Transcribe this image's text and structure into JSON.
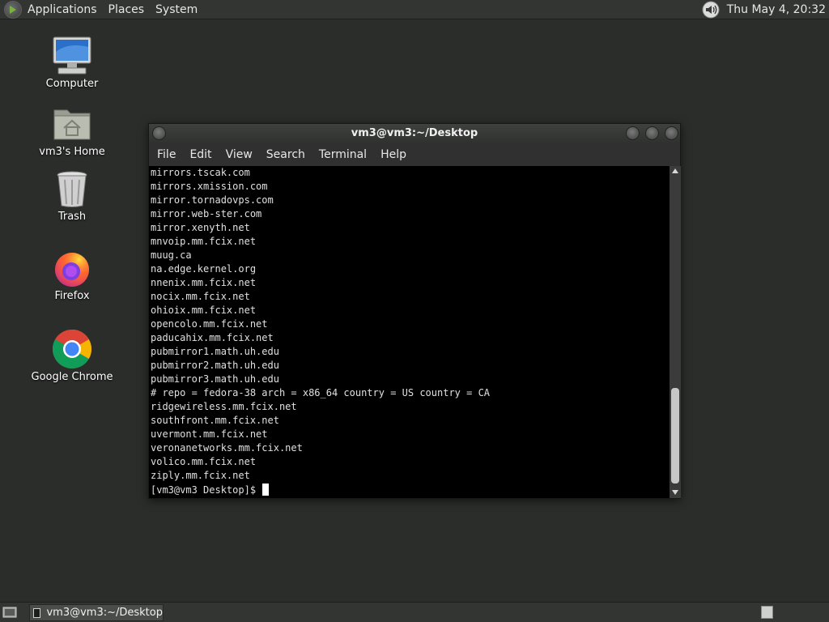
{
  "top_panel": {
    "menus": [
      "Applications",
      "Places",
      "System"
    ],
    "clock": "Thu May  4, 20:32"
  },
  "desktop": {
    "icons": [
      {
        "label": "Computer",
        "icon": "computer-icon"
      },
      {
        "label": "vm3's Home",
        "icon": "home-folder-icon"
      },
      {
        "label": "Trash",
        "icon": "trash-icon"
      },
      {
        "label": "Firefox",
        "icon": "firefox-icon"
      },
      {
        "label": "Google Chrome",
        "icon": "chrome-icon"
      }
    ]
  },
  "terminal": {
    "title": "vm3@vm3:~/Desktop",
    "menus": [
      "File",
      "Edit",
      "View",
      "Search",
      "Terminal",
      "Help"
    ],
    "lines": [
      "mirrors.tscak.com",
      "mirrors.xmission.com",
      "mirror.tornadovps.com",
      "mirror.web-ster.com",
      "mirror.xenyth.net",
      "mnvoip.mm.fcix.net",
      "muug.ca",
      "na.edge.kernel.org",
      "nnenix.mm.fcix.net",
      "nocix.mm.fcix.net",
      "ohioix.mm.fcix.net",
      "opencolo.mm.fcix.net",
      "paducahix.mm.fcix.net",
      "pubmirror1.math.uh.edu",
      "pubmirror2.math.uh.edu",
      "pubmirror3.math.uh.edu",
      "# repo = fedora-38 arch = x86_64 country = US country = CA",
      "ridgewireless.mm.fcix.net",
      "southfront.mm.fcix.net",
      "uvermont.mm.fcix.net",
      "veronanetworks.mm.fcix.net",
      "volico.mm.fcix.net",
      "ziply.mm.fcix.net"
    ],
    "prompt": "[vm3@vm3 Desktop]$ "
  },
  "bottom_panel": {
    "task_label": "vm3@vm3:~/Desktop"
  },
  "colors": {
    "desktop_bg": "#2b2d2b",
    "panel_bg": "#333533",
    "terminal_bg": "#000000",
    "terminal_fg": "#e0e0e0"
  }
}
